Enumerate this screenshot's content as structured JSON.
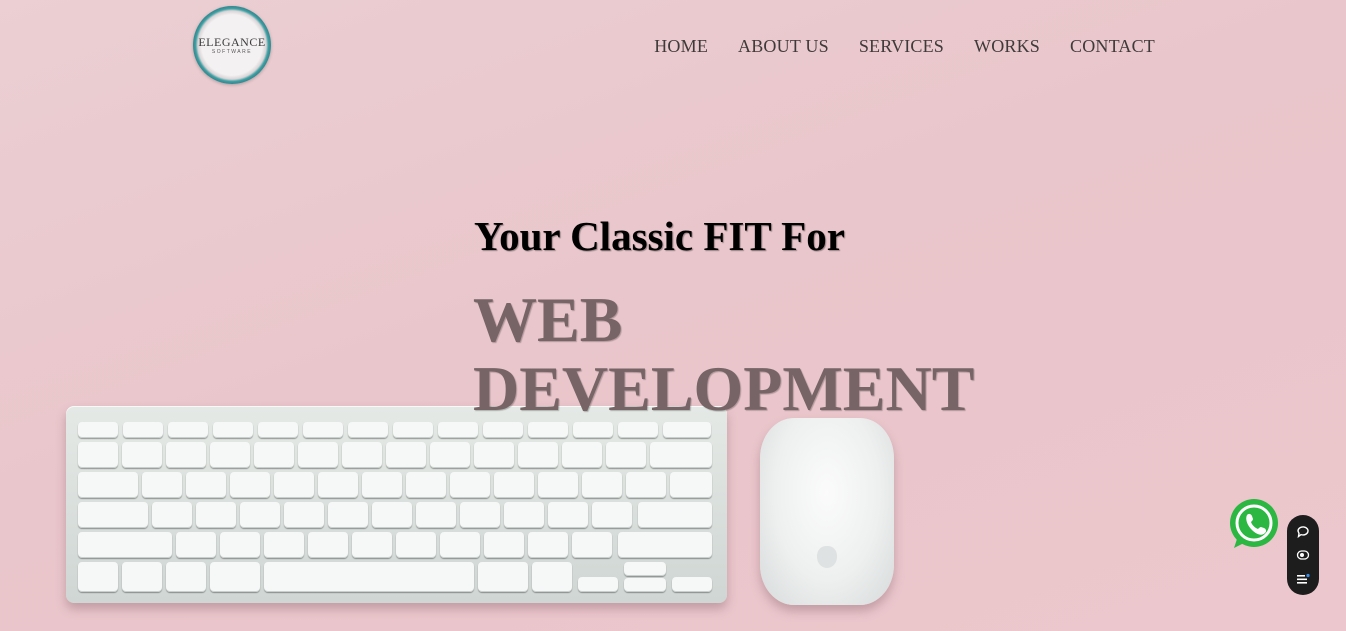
{
  "header": {
    "logo_text": "ELEGANCE",
    "logo_subtext": "SOFTWARE",
    "nav": [
      {
        "label": "HOME"
      },
      {
        "label": "ABOUT US"
      },
      {
        "label": "SERVICES"
      },
      {
        "label": "WORKS"
      },
      {
        "label": "CONTACT"
      }
    ]
  },
  "hero": {
    "subtitle": "Your Classic FIT For",
    "title_line1": "WEB",
    "title_line2": "DEVELOPMENT"
  },
  "floating": {
    "whatsapp_icon": "whatsapp-icon",
    "tools": [
      "chat-icon",
      "eye-icon",
      "menu-icon"
    ]
  },
  "colors": {
    "background": "#ebcfd3",
    "title": "#766466",
    "whatsapp": "#2bb741",
    "panel": "#1e1d1d"
  }
}
